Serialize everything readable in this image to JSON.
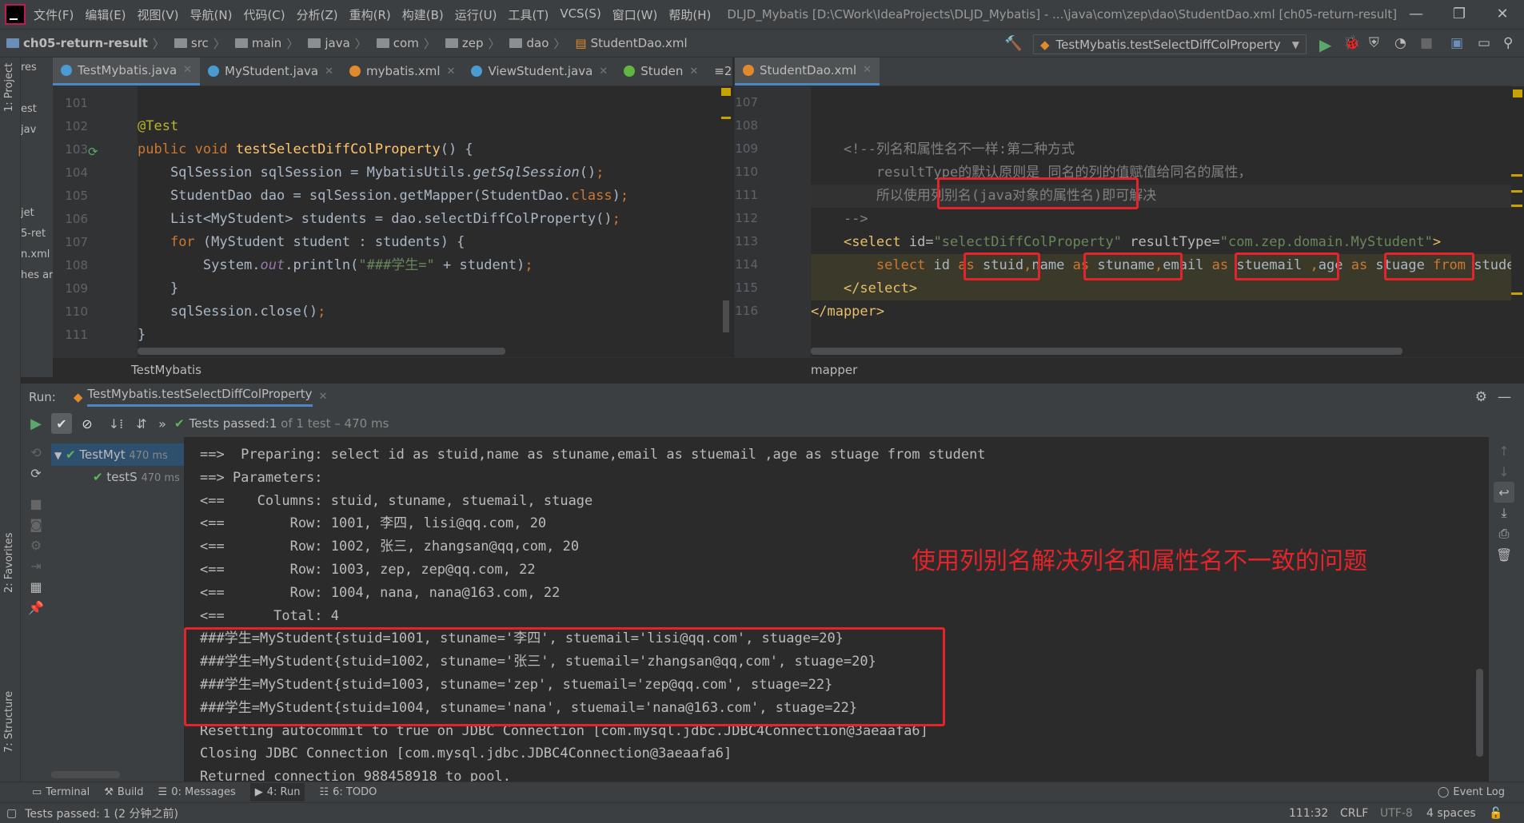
{
  "menubar": {
    "items": [
      "文件(F)",
      "编辑(E)",
      "视图(V)",
      "导航(N)",
      "代码(C)",
      "分析(Z)",
      "重构(R)",
      "构建(B)",
      "运行(U)",
      "工具(T)",
      "VCS(S)",
      "窗口(W)",
      "帮助(H)"
    ],
    "window_title": "DLJD_Mybatis [D:\\CWork\\IdeaProjects\\DLJD_Mybatis] - ...\\java\\com\\zep\\dao\\StudentDao.xml [ch05-return-result]"
  },
  "navbar": {
    "crumbs": [
      "ch05-return-result",
      "src",
      "main",
      "java",
      "com",
      "zep",
      "dao",
      "StudentDao.xml"
    ],
    "run_config": "TestMybatis.testSelectDiffColProperty"
  },
  "left_strip": {
    "project": "1: Project",
    "favorites": "2: Favorites",
    "structure": "7: Structure"
  },
  "project_panel": [
    "res",
    "",
    "est",
    "jav",
    "",
    "",
    "",
    "jet",
    "5-ret",
    "n.xml",
    "hes ar"
  ],
  "left_editor": {
    "tabs": [
      {
        "label": "TestMybatis.java",
        "color": "#4a9bd1"
      },
      {
        "label": "MyStudent.java",
        "color": "#4a9bd1"
      },
      {
        "label": "mybatis.xml",
        "color": "#e08a2d"
      },
      {
        "label": "ViewStudent.java",
        "color": "#4a9bd1"
      },
      {
        "label": "Studen",
        "color": "#62b543"
      }
    ],
    "tab_overflow": "≡2",
    "line_numbers": [
      "101",
      "102",
      "103",
      "104",
      "105",
      "106",
      "107",
      "108",
      "109",
      "110",
      "111"
    ],
    "breadcrumb": "TestMybatis"
  },
  "right_editor": {
    "tabs": [
      {
        "label": "StudentDao.xml",
        "color": "#e08a2d"
      }
    ],
    "line_numbers": [
      "107",
      "108",
      "109",
      "110",
      "111",
      "112",
      "113",
      "114",
      "115",
      "116"
    ],
    "breadcrumb": "mapper"
  },
  "run_panel": {
    "title": "Run:",
    "tab": "TestMybatis.testSelectDiffColProperty",
    "tests_passed_prefix": "Tests passed: ",
    "tests_passed_count": "1",
    "tests_passed_suffix": " of 1 test – 470 ms",
    "tree": [
      {
        "label": "TestMyt",
        "time": "470 ms"
      },
      {
        "label": "testS",
        "time": "470 ms"
      }
    ],
    "console": [
      "==>  Preparing: select id as stuid,name as stuname,email as stuemail ,age as stuage from student",
      "==> Parameters: ",
      "<==    Columns: stuid, stuname, stuemail, stuage",
      "<==        Row: 1001, 李四, lisi@qq.com, 20",
      "<==        Row: 1002, 张三, zhangsan@qq,com, 20",
      "<==        Row: 1003, zep, zep@qq.com, 22",
      "<==        Row: 1004, nana, nana@163.com, 22",
      "<==      Total: 4",
      "###学生=MyStudent{stuid=1001, stuname='李四', stuemail='lisi@qq.com', stuage=20}",
      "###学生=MyStudent{stuid=1002, stuname='张三', stuemail='zhangsan@qq,com', stuage=20}",
      "###学生=MyStudent{stuid=1003, stuname='zep', stuemail='zep@qq.com', stuage=22}",
      "###学生=MyStudent{stuid=1004, stuname='nana', stuemail='nana@163.com', stuage=22}",
      "Resetting autocommit to true on JDBC Connection [com.mysql.jdbc.JDBC4Connection@3aeaafa6]",
      "Closing JDBC Connection [com.mysql.jdbc.JDBC4Connection@3aeaafa6]",
      "Returned connection 988458918 to pool."
    ],
    "annotation": "使用列别名解决列名和属性名不一致的问题"
  },
  "bottom_tools": [
    {
      "label": "Terminal",
      "icon": "terminal-icon"
    },
    {
      "label": "Build",
      "icon": "hammer-icon"
    },
    {
      "label": "0: Messages",
      "icon": "messages-icon"
    },
    {
      "label": "4: Run",
      "icon": "run-icon"
    },
    {
      "label": "6: TODO",
      "icon": "todo-icon"
    }
  ],
  "event_log": "Event Log",
  "status": {
    "message": "Tests passed: 1 (2 分钟之前)",
    "position": "111:32",
    "line_sep": "CRLF",
    "encoding": "UTF-8",
    "indent": "4 spaces"
  },
  "colors": {
    "accent": "#4a88c7",
    "annotation_red": "#e3242b",
    "pass_green": "#5cb85c"
  }
}
